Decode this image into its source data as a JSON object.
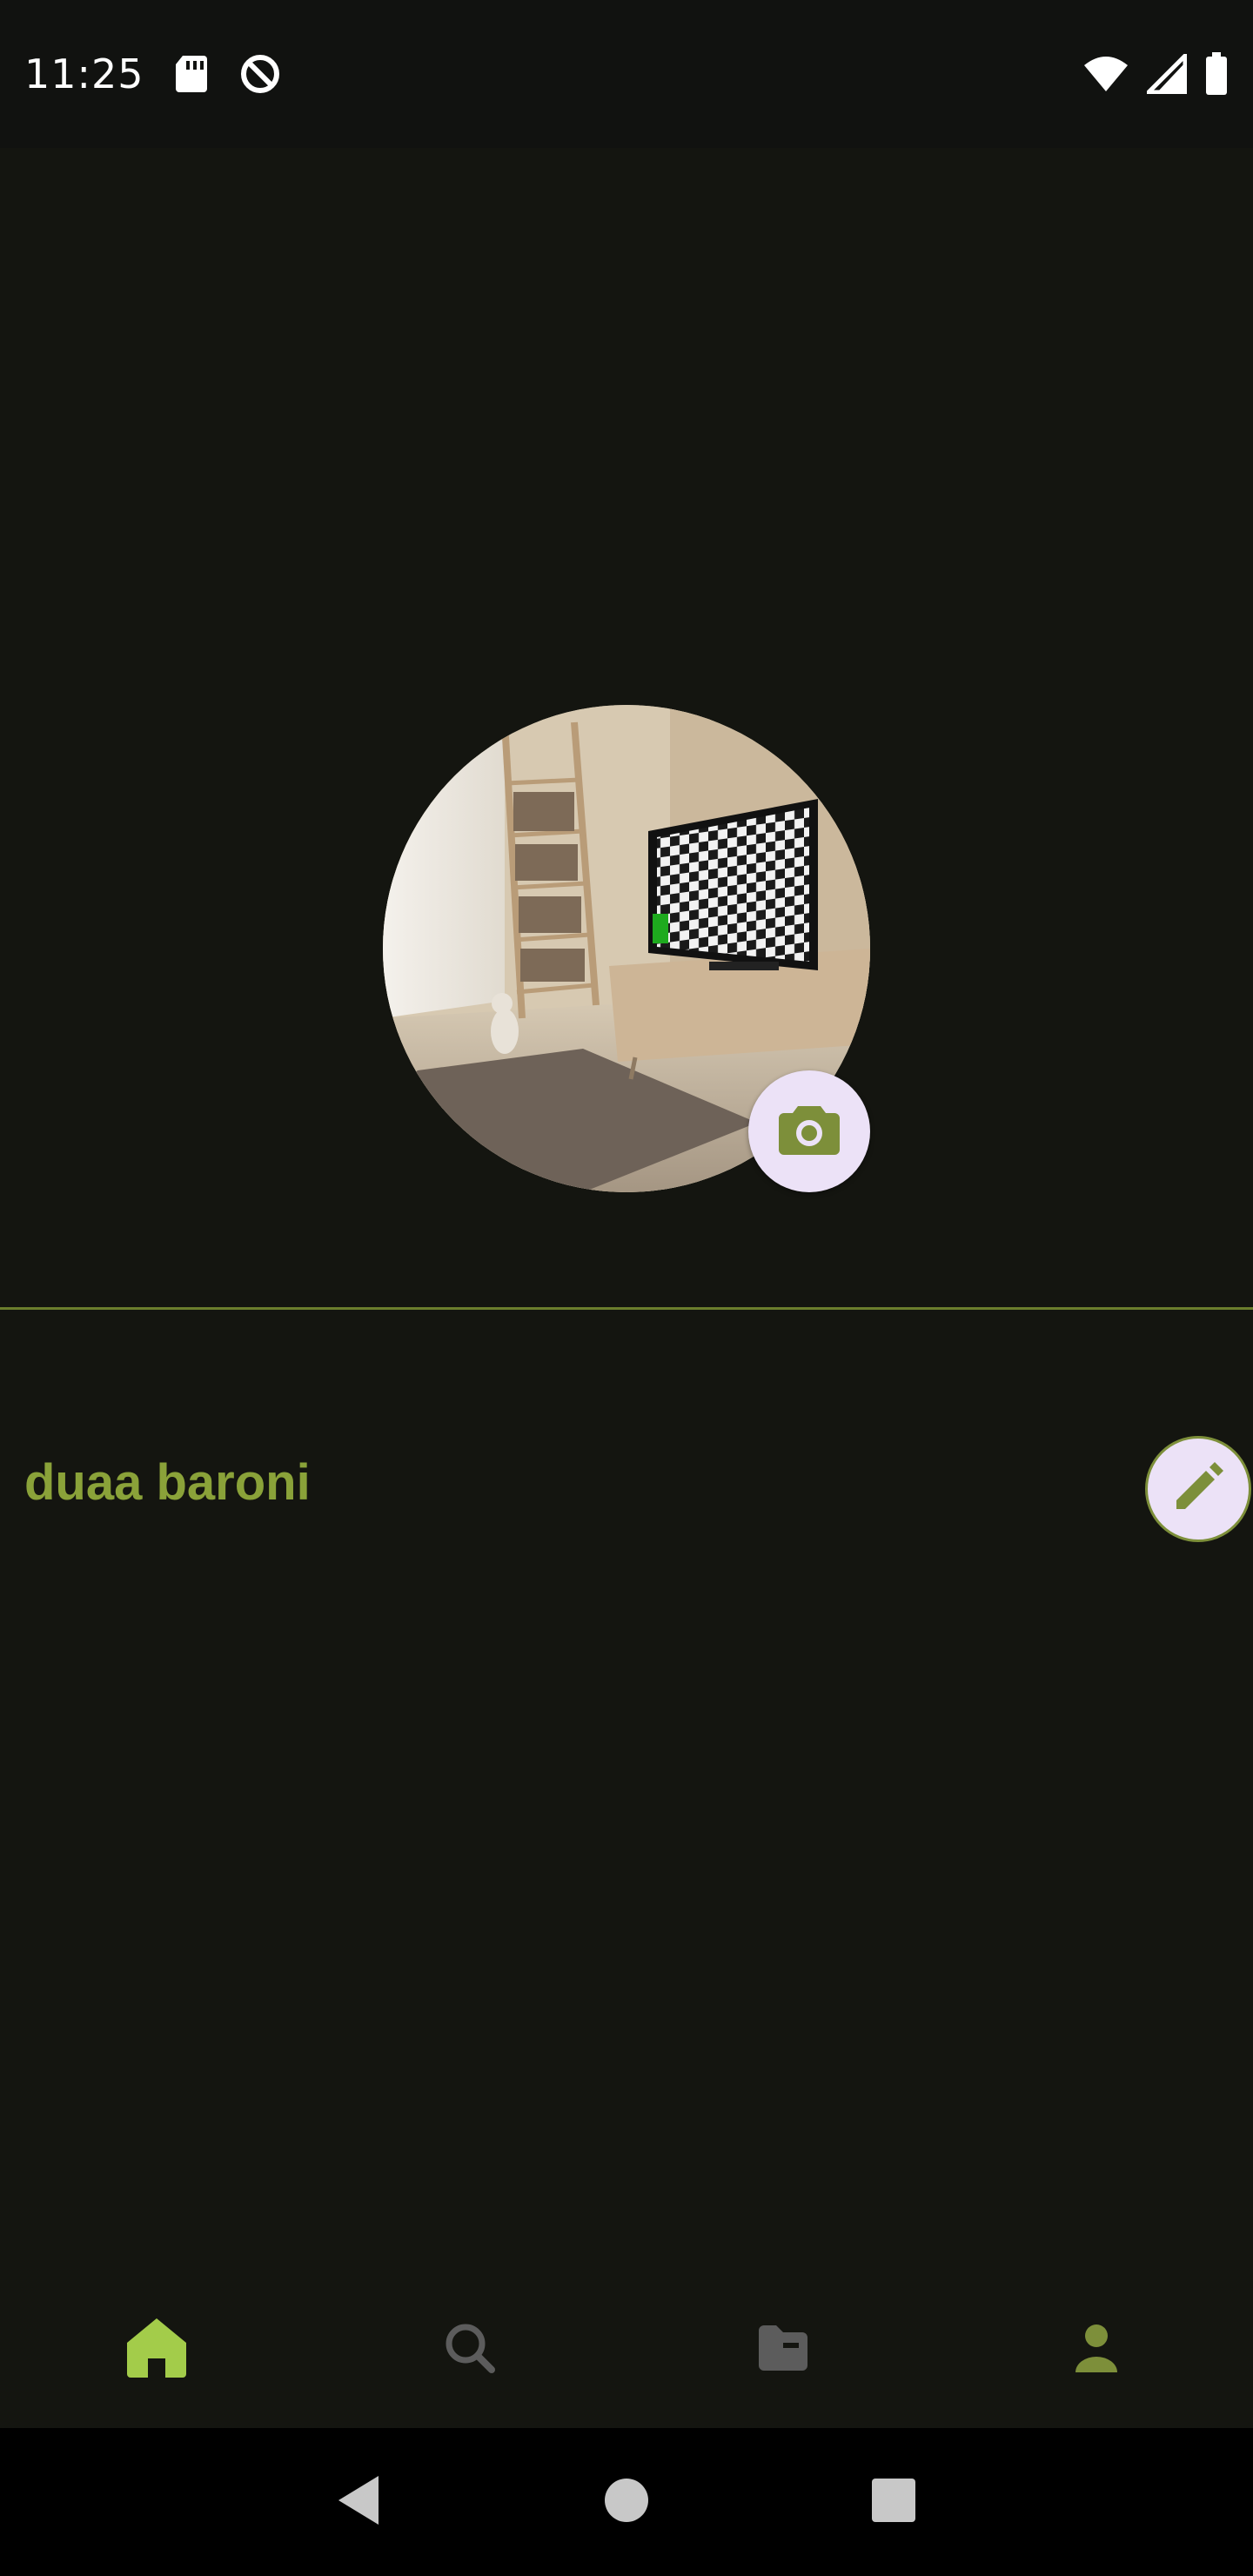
{
  "status_bar": {
    "time": "11:25",
    "icons_left": [
      "sd-card-icon",
      "do-not-disturb-icon"
    ],
    "icons_right": [
      "wifi-icon",
      "cell-signal-icon",
      "battery-icon"
    ]
  },
  "profile": {
    "name": "duaa baroni",
    "avatar_alt": "profile-photo",
    "camera_icon": "camera-icon",
    "edit_icon": "pencil-icon"
  },
  "bottom_nav": {
    "items": [
      {
        "id": "home",
        "icon": "home-icon",
        "active": true
      },
      {
        "id": "search",
        "icon": "search-icon",
        "active": false
      },
      {
        "id": "files",
        "icon": "folder-icon",
        "active": false
      },
      {
        "id": "profile",
        "icon": "person-icon",
        "active": false
      }
    ]
  },
  "system_nav": {
    "items": [
      "back-icon",
      "home-circle-icon",
      "recents-icon"
    ]
  },
  "colors": {
    "background": "#141510",
    "accent": "#8aa239",
    "active_nav": "#a3cc4a",
    "inactive_nav": "#5c5c5c",
    "button_bg": "#ece2f7"
  }
}
